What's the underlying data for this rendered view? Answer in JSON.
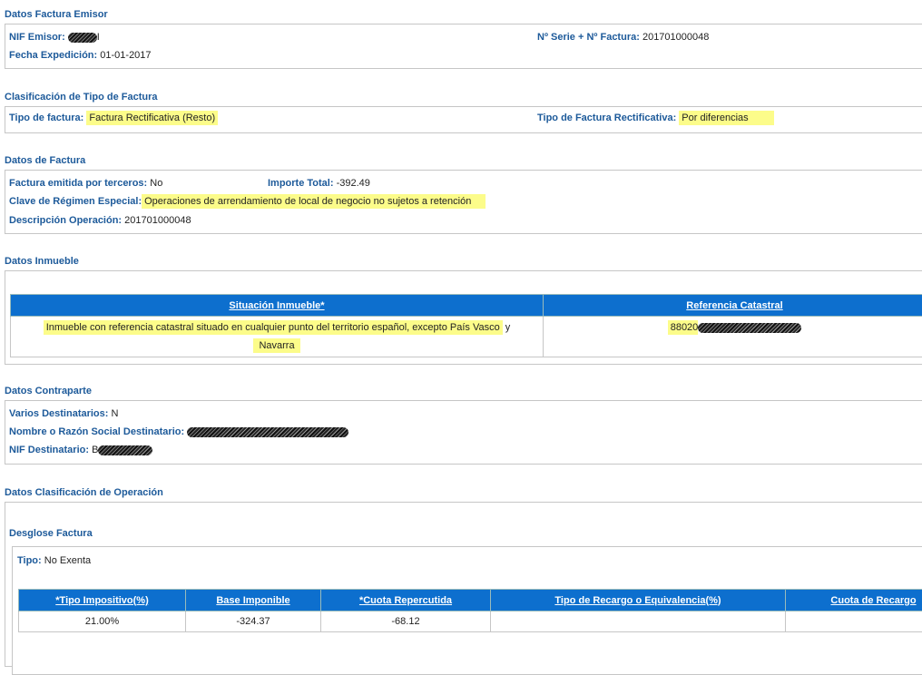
{
  "emisor": {
    "title": "Datos Factura Emisor",
    "nif_label": "NIF Emisor:",
    "nif_value_suffix": "I",
    "serie_label": "Nº Serie + Nº Factura:",
    "serie_value": "201701000048",
    "fecha_label": "Fecha Expedición:",
    "fecha_value": "01-01-2017"
  },
  "clasificacion": {
    "title": "Clasificación de Tipo de Factura",
    "tipo_label": "Tipo de factura:",
    "tipo_value": "Factura Rectificativa (Resto)",
    "rect_label": "Tipo de Factura Rectificativa:",
    "rect_value": "Por diferencias"
  },
  "factura": {
    "title": "Datos de Factura",
    "terceros_label": "Factura emitida por terceros:",
    "terceros_value": "No",
    "importe_label": "Importe Total:",
    "importe_value": "-392.49",
    "clave_label": "Clave de Régimen Especial:",
    "clave_value": "Operaciones de arrendamiento de local de negocio no sujetos a retención",
    "desc_label": "Descripción Operación:",
    "desc_value": "201701000048"
  },
  "inmueble": {
    "title": "Datos Inmueble",
    "col_situacion": "Situación Inmueble*",
    "col_referencia": "Referencia Catastral",
    "situacion_part1": "Inmueble con referencia catastral situado en cualquier punto del territorio español, excepto País Vasco",
    "situacion_y": "y",
    "situacion_part2": "Navarra",
    "referencia_prefix": "88020"
  },
  "contraparte": {
    "title": "Datos Contraparte",
    "varios_label": "Varios Destinatarios:",
    "varios_value": "N",
    "nombre_label": "Nombre o Razón Social Destinatario:",
    "nif_label": "NIF Destinatario:",
    "nif_prefix": "B"
  },
  "operacion": {
    "title": "Datos Clasificación de Operación",
    "desglose_title": "Desglose Factura",
    "tipo_label": "Tipo:",
    "tipo_value": "No Exenta",
    "columns": [
      "*Tipo Impositivo(%)",
      "Base Imponible",
      "*Cuota Repercutida",
      "Tipo de Recargo o Equivalencia(%)",
      "Cuota de Recargo"
    ],
    "row": [
      "21.00%",
      "-324.37",
      "-68.12",
      "",
      ""
    ]
  }
}
